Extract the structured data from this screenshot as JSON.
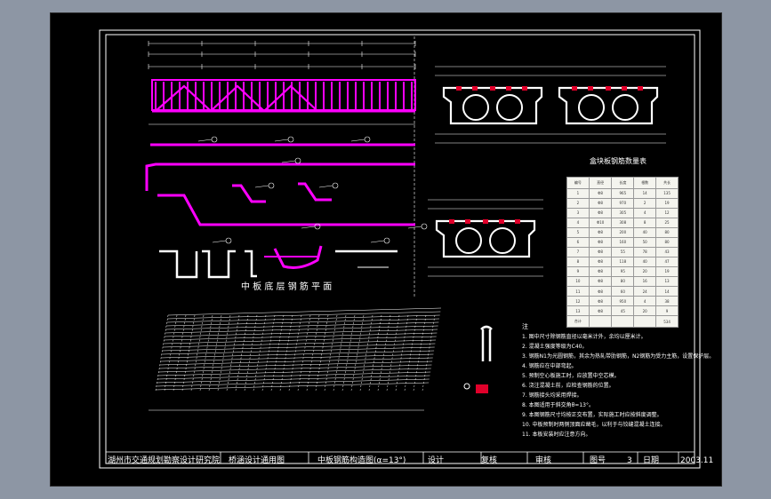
{
  "drawing": {
    "plan_title": "中 板 底 层 钢 筋 平 面",
    "table_title": "盒块板钢筋数量表",
    "notes_marker": "注",
    "notes": [
      "1. 图中尺寸除钢筋直径以毫米计外，余均以厘米计。",
      "2. 混凝土强度等级为C40。",
      "3. 钢筋N1为光圆钢筋，其余为热轧带肋钢筋，N2钢筋为受力主筋，设置保护层。",
      "4. 钢筋应在中部弯起。",
      "5. 预制空心板施工时，应放置中空芯模。",
      "6. 浇注混凝土前，应检查钢筋的位置。",
      "7. 钢筋接头均采用焊接。",
      "8. 本图适用于斜交角θ=13°。",
      "9. 本图钢筋尺寸均按正交布置，实际施工时应按斜度调整。",
      "10. 中板预制时两侧顶面应凿毛，以利于与铰缝混凝土连接。",
      "11. 本板安装时应注意方向。"
    ],
    "table": {
      "rows": [
        [
          "编号",
          "直径",
          "长度",
          "根数",
          "共长"
        ],
        [
          "1",
          "Φ8",
          "965",
          "14",
          "135"
        ],
        [
          "2",
          "Φ8",
          "970",
          "2",
          "19"
        ],
        [
          "3",
          "Φ8",
          "305",
          "4",
          "12"
        ],
        [
          "4",
          "Φ10",
          "308",
          "8",
          "25"
        ],
        [
          "5",
          "Φ8",
          "200",
          "40",
          "80"
        ],
        [
          "6",
          "Φ8",
          "160",
          "50",
          "80"
        ],
        [
          "7",
          "Φ8",
          "55",
          "78",
          "43"
        ],
        [
          "8",
          "Φ8",
          "118",
          "40",
          "47"
        ],
        [
          "9",
          "Φ8",
          "95",
          "20",
          "19"
        ],
        [
          "10",
          "Φ8",
          "80",
          "16",
          "13"
        ],
        [
          "11",
          "Φ8",
          "60",
          "24",
          "14"
        ],
        [
          "12",
          "Φ8",
          "950",
          "4",
          "38"
        ],
        [
          "13",
          "Φ8",
          "45",
          "20",
          "9"
        ],
        [
          "合计",
          "",
          "",
          "",
          "534"
        ]
      ]
    }
  },
  "title_block": {
    "institute": "湖州市交通规划勘察设计研究院",
    "project": "桥涵设计通用图",
    "drawing_name": "中板钢筋构造图(α=13°)",
    "design_label": "设计",
    "review_label": "复核",
    "approve_label": "审核",
    "sheet_label": "图号",
    "sheet_no": "3",
    "date_label": "日期",
    "date": "2003.11"
  },
  "colors": {
    "background": "#000000",
    "rebar": "#ff00ff",
    "line": "#ffffff",
    "window": "#8d96a4"
  }
}
